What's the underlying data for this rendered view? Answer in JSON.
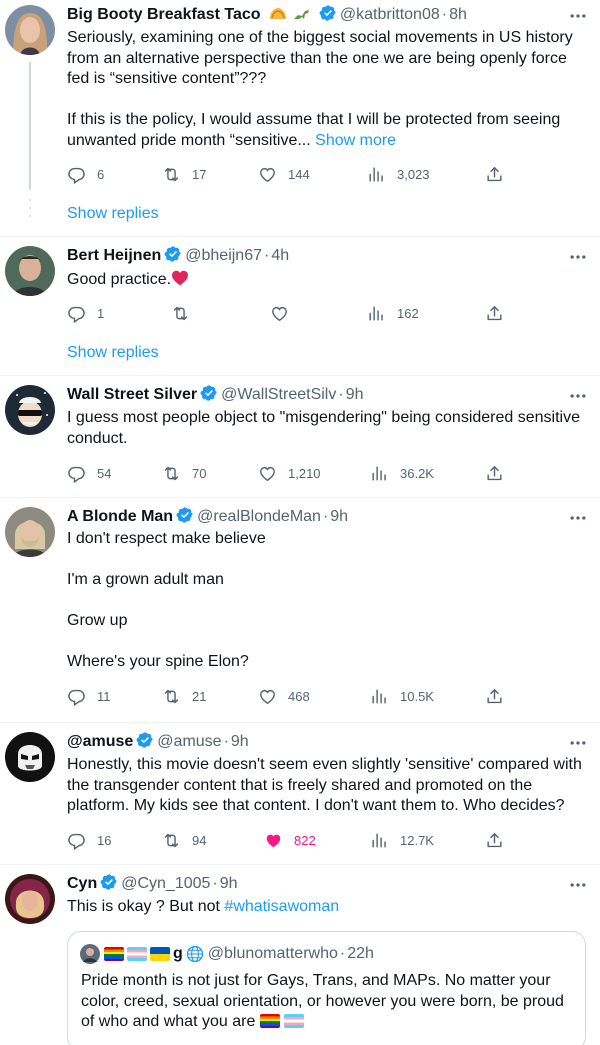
{
  "tweets": [
    {
      "name": "Big Booty Breakfast Taco",
      "name_emojis": [
        "taco-emoji",
        "dinosaur-emoji"
      ],
      "handle": "@katbritton08",
      "time": "8h",
      "text_lines": [
        "Seriously, examining one of the biggest social movements in US history",
        "from an alternative perspective than the one we are being openly force",
        "fed is “sensitive content”???"
      ],
      "text2": "If this is the policy, I would assume that I will be protected from seeing unwanted pride month “sensitive...",
      "show_more": "Show more",
      "replies": "6",
      "retweets": "17",
      "likes": "144",
      "views": "3,023",
      "show_replies": "Show replies"
    },
    {
      "name": "Bert Heijnen",
      "handle": "@bheijn67",
      "time": "4h",
      "text": "Good practice.",
      "text_emoji": "heart-emoji",
      "replies": "1",
      "retweets": "",
      "likes": "",
      "views": "162",
      "show_replies": "Show replies"
    },
    {
      "name": "Wall Street Silver",
      "handle": "@WallStreetSilv",
      "time": "9h",
      "text": "I guess most people object to \"misgendering\" being considered sensitive conduct.",
      "replies": "54",
      "retweets": "70",
      "likes": "1,210",
      "views": "36.2K"
    },
    {
      "name": "A Blonde Man",
      "handle": "@realBlondeMan",
      "time": "9h",
      "paragraphs": [
        "I don't respect make believe",
        "I'm a grown adult man",
        "Grow up",
        "Where's your spine Elon?"
      ],
      "replies": "11",
      "retweets": "21",
      "likes": "468",
      "views": "10.5K"
    },
    {
      "name": "@amuse",
      "handle": "@amuse",
      "time": "9h",
      "text": "Honestly, this movie doesn't seem even slightly 'sensitive' compared with the transgender content that is freely shared and promoted on the platform. My kids see that content. I don't want them to. Who decides?",
      "replies": "16",
      "retweets": "94",
      "likes": "822",
      "views": "12.7K",
      "liked": true
    },
    {
      "name": "Cyn",
      "handle": "@Cyn_1005",
      "time": "9h",
      "text": "This is okay ? But not",
      "hashtag": "#whatisawoman",
      "quote": {
        "name": "g",
        "handle": "@blunomatterwho",
        "time": "22h",
        "text": "Pride month is not just for Gays, Trans, and MAPs. No matter your color, creed, sexual orientation, or however you were born, be proud of who and what you are"
      }
    }
  ],
  "colors": {
    "accent": "#1d9bf0",
    "like": "#f91880",
    "secondary": "#536471"
  }
}
